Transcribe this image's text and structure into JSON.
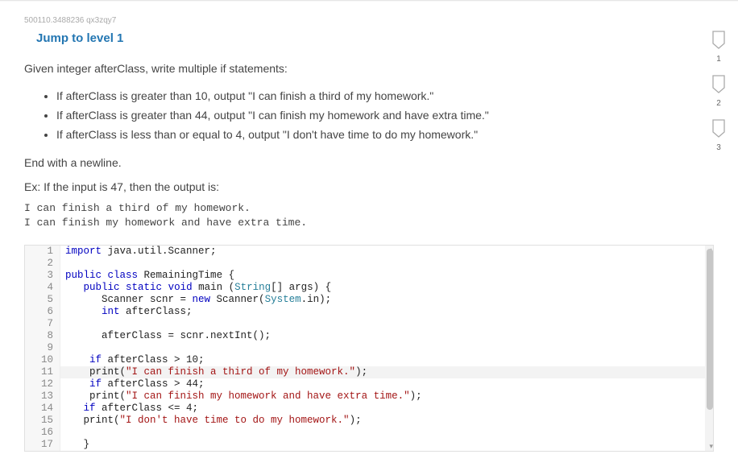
{
  "hash": "500110.3488236 qx3zqy7",
  "jump_label": "Jump to level 1",
  "prompt_intro": "Given integer afterClass, write multiple if statements:",
  "bullets": [
    "If afterClass is greater than 10, output \"I can finish a third of my homework.\"",
    "If afterClass is greater than 44, output \"I can finish my homework and have extra time.\"",
    "If afterClass is less than or equal to 4, output \"I don't have time to do my homework.\""
  ],
  "end_text": "End with a newline.",
  "example_label": "Ex: If the input is 47, then the output is:",
  "example_output": "I can finish a third of my homework.\nI can finish my homework and have extra time.",
  "code": {
    "lines": [
      {
        "n": 1,
        "segs": [
          {
            "t": "import",
            "c": "kw"
          },
          {
            "t": " java.util.Scanner;",
            "c": "plain"
          }
        ]
      },
      {
        "n": 2,
        "segs": []
      },
      {
        "n": 3,
        "segs": [
          {
            "t": "public",
            "c": "kw"
          },
          {
            "t": " ",
            "c": "plain"
          },
          {
            "t": "class",
            "c": "kw"
          },
          {
            "t": " RemainingTime {",
            "c": "plain"
          }
        ]
      },
      {
        "n": 4,
        "segs": [
          {
            "t": "   ",
            "c": "plain"
          },
          {
            "t": "public",
            "c": "kw"
          },
          {
            "t": " ",
            "c": "plain"
          },
          {
            "t": "static",
            "c": "kw"
          },
          {
            "t": " ",
            "c": "plain"
          },
          {
            "t": "void",
            "c": "kw"
          },
          {
            "t": " main (",
            "c": "plain"
          },
          {
            "t": "String",
            "c": "type"
          },
          {
            "t": "[] args) {",
            "c": "plain"
          }
        ]
      },
      {
        "n": 5,
        "segs": [
          {
            "t": "      Scanner scnr = ",
            "c": "plain"
          },
          {
            "t": "new",
            "c": "kw"
          },
          {
            "t": " Scanner(",
            "c": "plain"
          },
          {
            "t": "System",
            "c": "type"
          },
          {
            "t": ".in);",
            "c": "plain"
          }
        ]
      },
      {
        "n": 6,
        "segs": [
          {
            "t": "      ",
            "c": "plain"
          },
          {
            "t": "int",
            "c": "kw"
          },
          {
            "t": " afterClass;",
            "c": "plain"
          }
        ]
      },
      {
        "n": 7,
        "segs": []
      },
      {
        "n": 8,
        "segs": [
          {
            "t": "      afterClass = scnr.nextInt();",
            "c": "plain"
          }
        ]
      },
      {
        "n": 9,
        "segs": []
      },
      {
        "n": 10,
        "segs": [
          {
            "t": "    ",
            "c": "plain"
          },
          {
            "t": "if",
            "c": "kw"
          },
          {
            "t": " afterClass > 10;",
            "c": "plain"
          }
        ]
      },
      {
        "n": 11,
        "hl": true,
        "segs": [
          {
            "t": "    print(",
            "c": "plain"
          },
          {
            "t": "\"I can finish a third of my homework.\"",
            "c": "str"
          },
          {
            "t": ");",
            "c": "plain"
          }
        ]
      },
      {
        "n": 12,
        "segs": [
          {
            "t": "    ",
            "c": "plain"
          },
          {
            "t": "if",
            "c": "kw"
          },
          {
            "t": " afterClass > 44;",
            "c": "plain"
          }
        ]
      },
      {
        "n": 13,
        "segs": [
          {
            "t": "    print(",
            "c": "plain"
          },
          {
            "t": "\"I can finish my homework and have extra time.\"",
            "c": "str"
          },
          {
            "t": ");",
            "c": "plain"
          }
        ]
      },
      {
        "n": 14,
        "segs": [
          {
            "t": "   ",
            "c": "plain"
          },
          {
            "t": "if",
            "c": "kw"
          },
          {
            "t": " afterClass <= 4;",
            "c": "plain"
          }
        ]
      },
      {
        "n": 15,
        "segs": [
          {
            "t": "   print(",
            "c": "plain"
          },
          {
            "t": "\"I don't have time to do my homework.\"",
            "c": "str"
          },
          {
            "t": ");",
            "c": "plain"
          }
        ]
      },
      {
        "n": 16,
        "segs": []
      },
      {
        "n": 17,
        "segs": [
          {
            "t": "   }",
            "c": "plain"
          }
        ]
      }
    ]
  },
  "flags": [
    "1",
    "2",
    "3"
  ]
}
